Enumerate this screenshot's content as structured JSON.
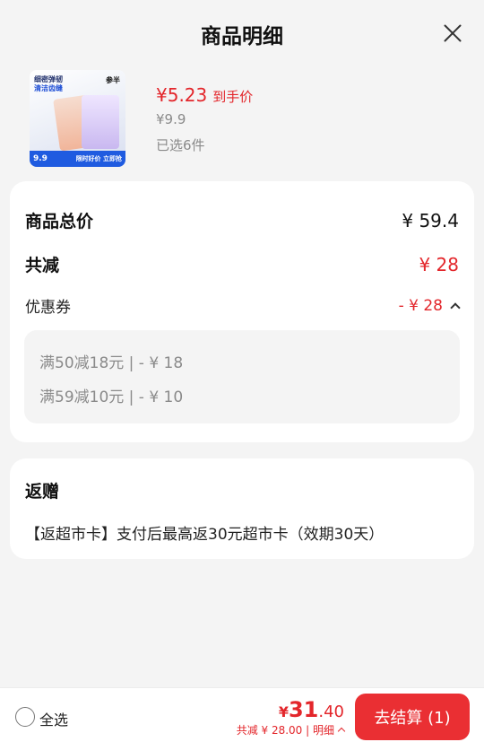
{
  "header": {
    "title": "商品明细"
  },
  "product": {
    "image": {
      "line1": "细密弹韧",
      "line2": "清洁齿缝",
      "brand": "参半",
      "band_price": "9.9",
      "band_text": "限时好价 立即抢"
    },
    "price": "¥5.23",
    "price_tag": "到手价",
    "original_price": "¥9.9",
    "selected": "已选6件"
  },
  "summary": {
    "total_label": "商品总价",
    "total_value": "¥ 59.4",
    "reduce_label": "共减",
    "reduce_value": "¥ 28",
    "coupon_label": "优惠券",
    "coupon_value": "- ¥ 28",
    "coupons": [
      "满50减18元 | - ¥ 18",
      "满59减10元 | - ¥ 10"
    ]
  },
  "gift": {
    "title": "返赠",
    "desc": "【返超市卡】支付后最高返30元超市卡（效期30天）"
  },
  "footer": {
    "select_all": "全选",
    "currency": "¥",
    "total_int": "31",
    "total_dec": ".40",
    "sub_text": "共减 ¥ 28.00 | 明细",
    "checkout": "去结算 (1)"
  },
  "colors": {
    "accent": "#e3262b",
    "checkout_bg": "#ea2f33",
    "page_bg": "#f4f4f4"
  }
}
